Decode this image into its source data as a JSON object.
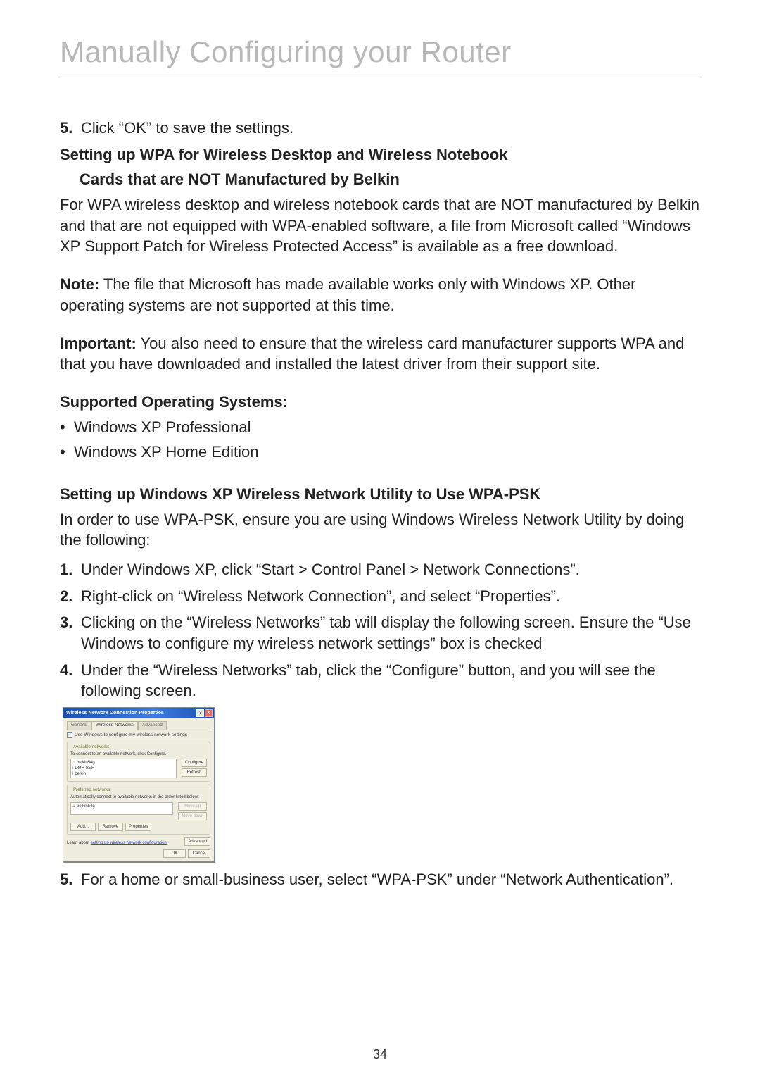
{
  "title": "Manually Configuring your Router",
  "page_number": "34",
  "s1": {
    "n5": "5.",
    "n5_text": "Click “OK” to save the settings."
  },
  "h1_line1": "Setting up WPA for Wireless Desktop and Wireless Notebook",
  "h1_line2": "Cards that are NOT Manufactured by Belkin",
  "p1": "For WPA wireless desktop and wireless notebook cards that are NOT manufactured by Belkin and that are not equipped with WPA-enabled software, a file from Microsoft called “Windows XP Support Patch for Wireless Protected Access” is available as a free download.",
  "note_label": "Note:",
  "note_text": " The file that Microsoft has made available works only with Windows XP. Other operating systems are not supported at this time.",
  "imp_label": "Important:",
  "imp_text": " You also need to ensure that the wireless card manufacturer supports WPA and that you have downloaded and installed the latest driver from their support site.",
  "h2": "Supported Operating Systems:",
  "bullets": {
    "b1": "Windows XP Professional",
    "b2": "Windows XP Home Edition"
  },
  "h3": "Setting up Windows XP Wireless Network Utility to Use WPA-PSK",
  "p2": "In order to use WPA-PSK, ensure you are using Windows Wireless Network Utility by doing the following:",
  "steps": {
    "n1": "1.",
    "t1": "Under Windows XP, click “Start > Control Panel > Network Connections”.",
    "n2": "2.",
    "t2": "Right-click on “Wireless Network Connection”, and select “Properties”.",
    "n3": "3.",
    "t3": "Clicking on the “Wireless Networks” tab will display the following screen. Ensure the “Use Windows to configure my wireless network settings” box is checked",
    "n4": "4.",
    "t4": "Under the “Wireless Networks” tab, click the “Configure” button, and you will see the following screen.",
    "n5": "5.",
    "t5": "For a home or small-business user, select “WPA-PSK” under “Network Authentication”."
  },
  "xp": {
    "title": "Wireless Network Connection Properties",
    "help": "?",
    "close": "X",
    "tabs": {
      "general": "General",
      "wireless": "Wireless Networks",
      "advanced": "Advanced"
    },
    "checkbox_mark": "✓",
    "checkbox_label": "Use Windows to configure my wireless network settings",
    "available_title": "Available networks:",
    "available_help": "To connect to an available network, click Configure.",
    "avail": {
      "a1": "belkin54g",
      "a2": "DMR-BVH",
      "a3": "belkin"
    },
    "btn_configure": "Configure",
    "btn_refresh": "Refresh",
    "preferred_title": "Preferred networks:",
    "preferred_help": "Automatically connect to available networks in the order listed below:",
    "pref": {
      "p1": "belkin54g"
    },
    "btn_moveup": "Move up",
    "btn_movedown": "Move down",
    "btn_add": "Add...",
    "btn_remove": "Remove",
    "btn_props": "Properties",
    "learn": "Learn about ",
    "learn_link": "setting up wireless network configuration",
    "btn_adv": "Advanced",
    "btn_ok": "OK",
    "btn_cancel": "Cancel"
  }
}
